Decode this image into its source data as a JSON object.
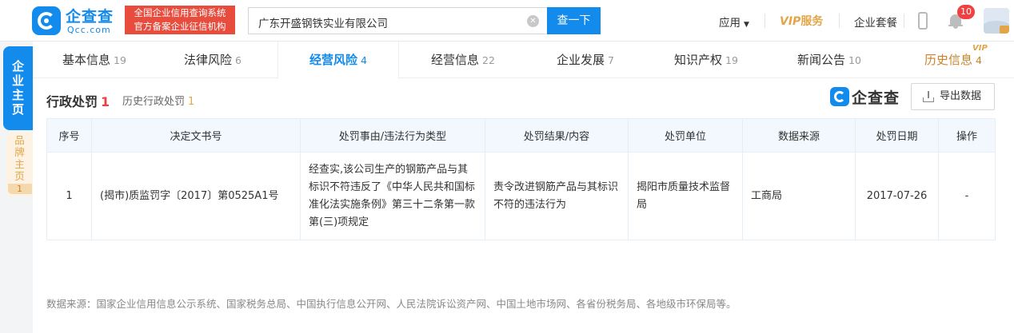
{
  "header": {
    "logo_cn": "企查查",
    "logo_en": "Qcc.com",
    "cert_line1": "全国企业信用查询系统",
    "cert_line2": "官方备案企业征信机构",
    "search_value": "广东开盛钢铁实业有限公司",
    "search_button": "查一下",
    "apps": "应用",
    "vip": "VIP",
    "vip_service": "服务",
    "package": "企业套餐",
    "notification_count": "10"
  },
  "side": {
    "main_tab": "企业主页",
    "brand_tab": "品牌主页",
    "brand_count": "1"
  },
  "tabs": [
    {
      "label": "基本信息",
      "count": "19"
    },
    {
      "label": "法律风险",
      "count": "6"
    },
    {
      "label": "经营风险",
      "count": "4"
    },
    {
      "label": "经营信息",
      "count": "22"
    },
    {
      "label": "企业发展",
      "count": "7"
    },
    {
      "label": "知识产权",
      "count": "19"
    },
    {
      "label": "新闻公告",
      "count": "10"
    },
    {
      "label": "历史信息",
      "count": "4"
    }
  ],
  "history_vip_tag": "VIP",
  "section": {
    "title": "行政处罚",
    "count": "1",
    "history_label": "历史行政处罚",
    "history_count": "1",
    "watermark": "企查查",
    "export_label": "导出数据"
  },
  "table": {
    "columns": [
      "序号",
      "决定文书号",
      "处罚事由/违法行为类型",
      "处罚结果/内容",
      "处罚单位",
      "数据来源",
      "处罚日期",
      "操作"
    ],
    "rows": [
      {
        "index": "1",
        "doc_no": "(揭市)质监罚字〔2017〕第0525A1号",
        "reason": "经查实,该公司生产的钢筋产品与其标识不符违反了《中华人民共和国标准化法实施条例》第三十二条第一款第(三)项规定",
        "result": "责令改进钢筋产品与其标识不符的违法行为",
        "unit": "揭阳市质量技术监督局",
        "source": "工商局",
        "date": "2017-07-26",
        "action": "-"
      }
    ]
  },
  "footer_note": "数据来源：国家企业信用信息公示系统、国家税务总局、中国执行信息公开网、人民法院诉讼资产网、中国土地市场网、各省份税务局、各地级市环保局等。",
  "colors": {
    "brand_blue": "#128bed",
    "vip_gold": "#e2a548",
    "alert_red": "#f04142",
    "cert_red": "#e84c3d"
  }
}
